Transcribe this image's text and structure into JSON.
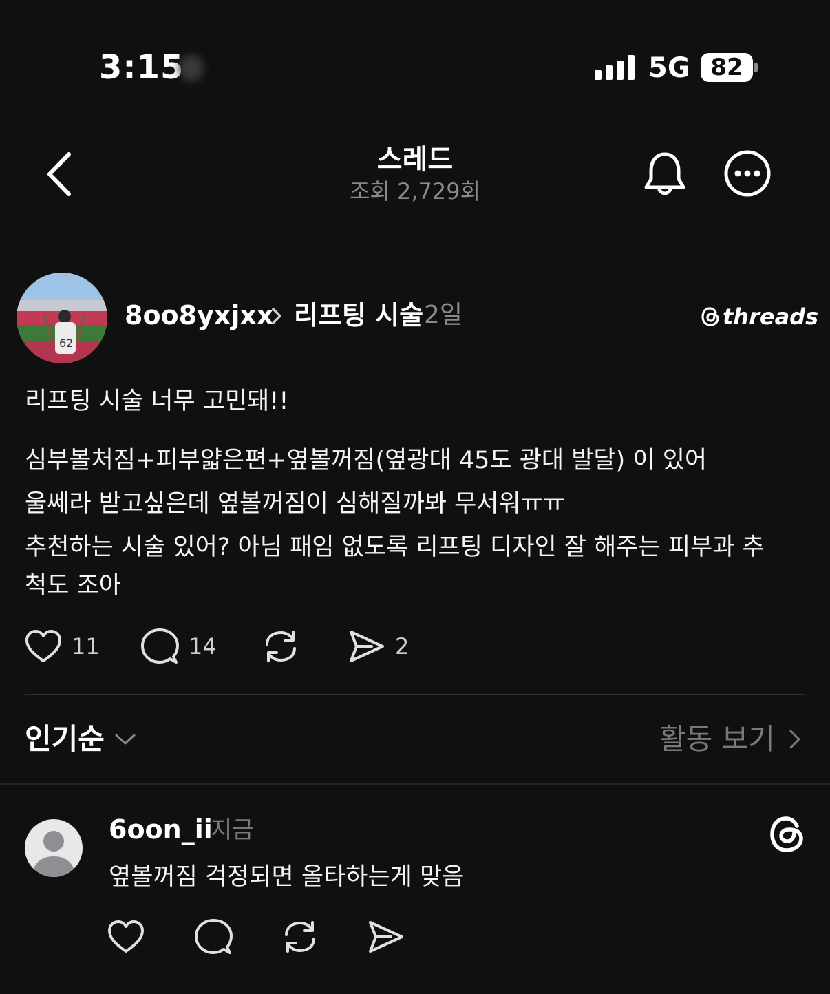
{
  "status_bar": {
    "time": "3:15",
    "network": "5G",
    "battery": "82"
  },
  "header": {
    "title": "스레드",
    "views": "조회 2,729회"
  },
  "post": {
    "username": "8oo8yxjxx",
    "topic": "리프팅 시술",
    "age": "2일",
    "brand": "threads",
    "paragraphs": [
      "리프팅 시술 너무 고민돼!!",
      "심부볼처짐+피부얇은편+옆볼꺼짐(옆광대 45도 광대 발달) 이 있어",
      "울쎄라 받고싶은데 옆볼꺼짐이 심해질까봐 무서워ㅠㅠ",
      "추천하는 시술 있어? 아님 패임 없도록 리프팅 디자인 잘 해주는 피부과 추",
      "척도 조아"
    ],
    "likes": "11",
    "comments": "14",
    "shares": "2"
  },
  "sort": {
    "label": "인기순",
    "activity": "활동 보기"
  },
  "reply": {
    "username": "6oon_ii",
    "time": "지금",
    "text": "옆볼꺼짐 걱정되면 올타하는게 맞음"
  },
  "colors": {
    "background": "#101010",
    "text": "#f3f5f7",
    "muted": "#8a8a8a"
  }
}
